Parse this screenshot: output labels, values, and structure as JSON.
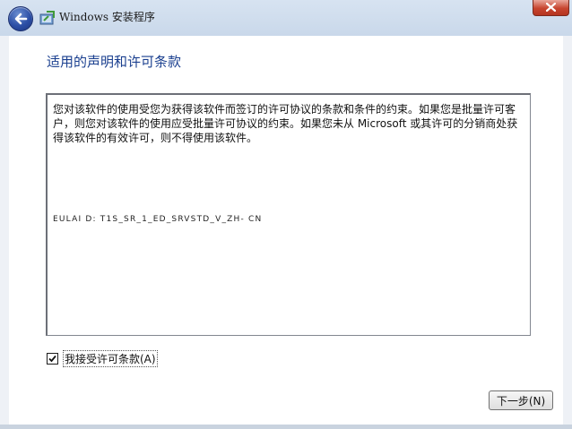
{
  "window": {
    "title": "Windows 安装程序",
    "back_icon": "back-arrow-icon",
    "app_icon": "windows-setup-icon",
    "close_icon": "close-icon"
  },
  "main": {
    "page_title": "适用的声明和许可条款",
    "license_text": "您对该软件的使用受您为获得该软件而签订的许可协议的条款和条件的约束。如果您是批量许可客户，则您对该软件的使用应受批量许可协议的约束。如果您未从 Microsoft 或其许可的分销商处获得该软件的有效许可，则不得使用该软件。",
    "eula_id": "EULAI D: T1S_SR_1_ED_SRVSTD_V_ZH- CN",
    "accept_label": "我接受许可条款(A)",
    "accept_checked": true,
    "next_label": "下一步(N)"
  },
  "colors": {
    "title_accent": "#1a3f8f",
    "close_red": "#c7452f",
    "back_blue": "#2c4fa6"
  }
}
